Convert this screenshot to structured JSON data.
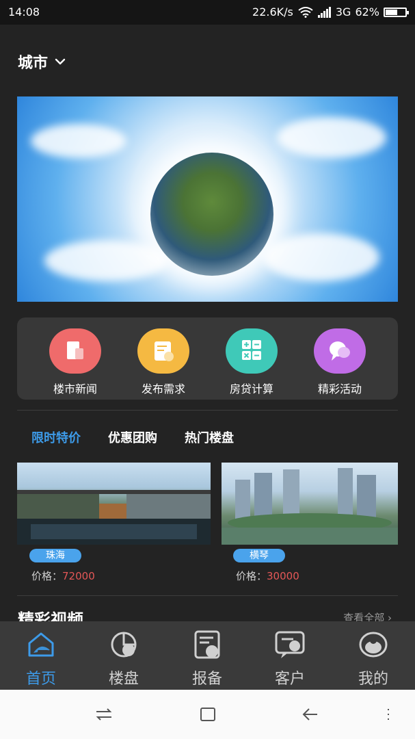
{
  "status_bar": {
    "time": "14:08",
    "speed": "22.6K/s",
    "network": "3G",
    "battery": "62%",
    "battery_level": 0.62
  },
  "header": {
    "city_label": "城市",
    "chevron_icon": "chevron-down-icon"
  },
  "quick_actions": [
    {
      "label": "楼市新闻",
      "icon": "news-icon",
      "color": "#ef6b6b"
    },
    {
      "label": "发布需求",
      "icon": "publish-icon",
      "color": "#f5b942"
    },
    {
      "label": "房贷计算",
      "icon": "calculator-icon",
      "color": "#3fc9b8"
    },
    {
      "label": "精彩活动",
      "icon": "activity-icon",
      "color": "#c06ce6"
    }
  ],
  "tabs": [
    {
      "label": "限时特价",
      "active": true
    },
    {
      "label": "优惠团购",
      "active": false
    },
    {
      "label": "热门楼盘",
      "active": false
    }
  ],
  "cards": [
    {
      "tag": "珠海",
      "price_label": "价格：",
      "price_value": "72000"
    },
    {
      "tag": "横琴",
      "price_label": "价格：",
      "price_value": "30000"
    }
  ],
  "section": {
    "title": "精彩视频",
    "view_all": "查看全部"
  },
  "bottom_nav": [
    {
      "label": "首页",
      "icon": "home-icon",
      "active": true
    },
    {
      "label": "楼盘",
      "icon": "building-icon",
      "active": false
    },
    {
      "label": "报备",
      "icon": "report-icon",
      "active": false
    },
    {
      "label": "客户",
      "icon": "customer-icon",
      "active": false
    },
    {
      "label": "我的",
      "icon": "profile-icon",
      "active": false
    }
  ],
  "colors": {
    "accent": "#3d9be9",
    "price": "#e45757",
    "background": "#232323"
  }
}
